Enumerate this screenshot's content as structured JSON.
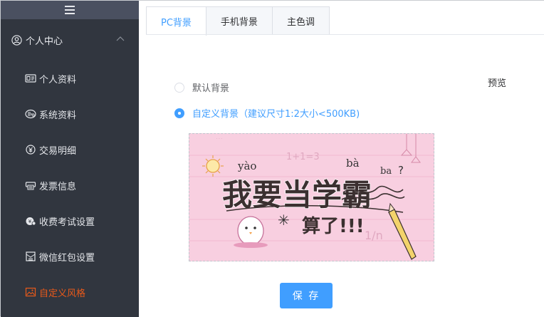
{
  "sidebar": {
    "group_label": "个人中心",
    "items": [
      {
        "label": "个人资料",
        "icon": "id-card-icon"
      },
      {
        "label": "系统资料",
        "icon": "system-gear-icon"
      },
      {
        "label": "交易明细",
        "icon": "yen-coin-icon"
      },
      {
        "label": "发票信息",
        "icon": "printer-icon"
      },
      {
        "label": "收费考试设置",
        "icon": "money-bag-icon"
      },
      {
        "label": "微信红包设置",
        "icon": "red-envelope-icon"
      },
      {
        "label": "自定义风格",
        "icon": "picture-icon"
      }
    ],
    "active_index": 6,
    "colors": {
      "background": "#31363f",
      "top_bar": "#4a5060",
      "active": "#e8591a"
    }
  },
  "tabs": [
    {
      "label": "PC背景"
    },
    {
      "label": "手机背景"
    },
    {
      "label": "主色调"
    }
  ],
  "active_tab": 0,
  "preview_label": "预览",
  "background_options": [
    {
      "label": "默认背景",
      "checked": false
    },
    {
      "label": "自定义背景（建议尺寸1:2大小<500KB)",
      "checked": true
    }
  ],
  "image": {
    "title_text": "我要当学霸",
    "pinyin": [
      "yào",
      "bà",
      "ba"
    ],
    "math_top": "1+1=3",
    "subtitle": "算了!!!",
    "corner_math": "1/n",
    "question": "?",
    "background_color": "#f8cfe0"
  },
  "save_button_label": "保 存",
  "accent_color": "#409eff"
}
